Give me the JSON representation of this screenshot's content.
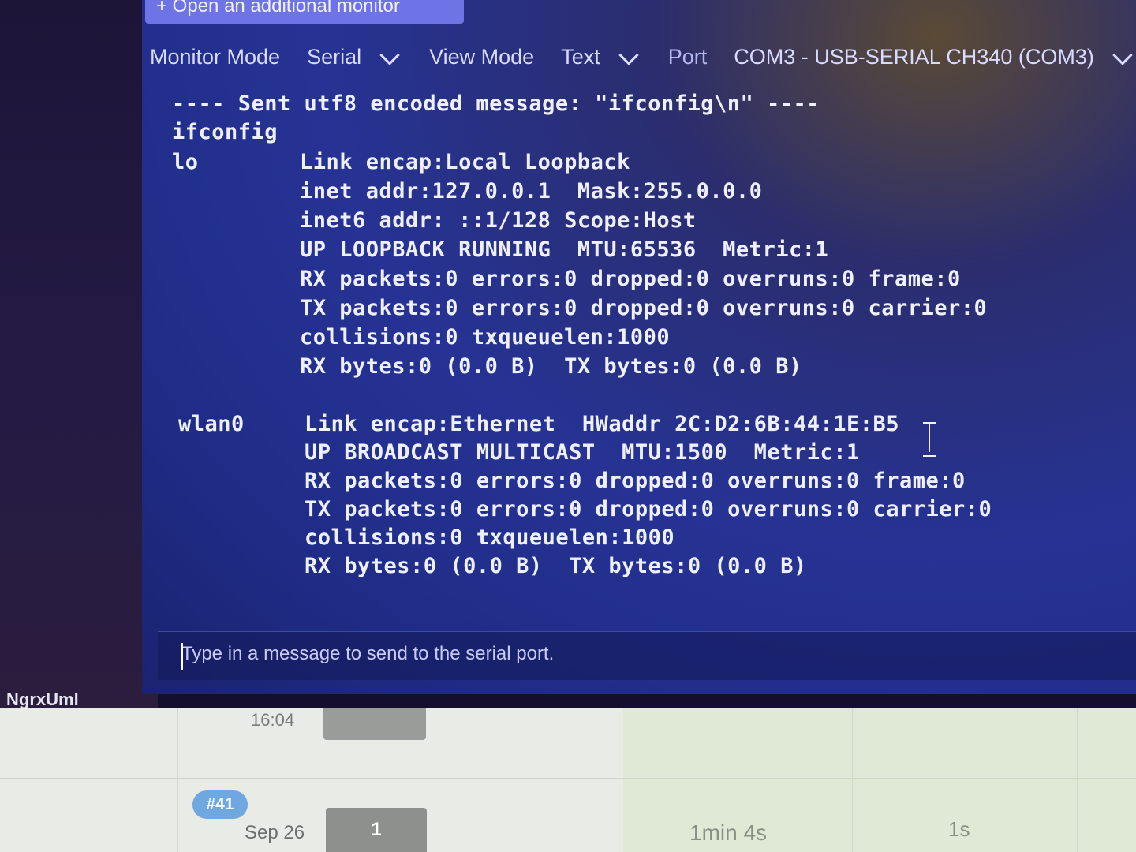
{
  "monitor": {
    "open_additional": "+ Open an additional monitor",
    "toolbar": {
      "monitor_mode_label": "Monitor Mode",
      "monitor_mode_value": "Serial",
      "view_mode_label": "View Mode",
      "view_mode_value": "Text",
      "port_label": "Port",
      "port_value": "COM3 - USB-SERIAL CH340 (COM3)"
    },
    "output": {
      "sent_line": "---- Sent utf8 encoded message: \"ifconfig\\n\" ----",
      "echo": "ifconfig",
      "interfaces": [
        {
          "name": "lo",
          "lines": [
            "Link encap:Local Loopback",
            "inet addr:127.0.0.1  Mask:255.0.0.0",
            "inet6 addr: ::1/128 Scope:Host",
            "UP LOOPBACK RUNNING  MTU:65536  Metric:1",
            "RX packets:0 errors:0 dropped:0 overruns:0 frame:0",
            "TX packets:0 errors:0 dropped:0 overruns:0 carrier:0",
            "collisions:0 txqueuelen:1000",
            "RX bytes:0 (0.0 B)  TX bytes:0 (0.0 B)"
          ]
        },
        {
          "name": "wlan0",
          "lines": [
            "Link encap:Ethernet  HWaddr 2C:D2:6B:44:1E:B5",
            "UP BROADCAST MULTICAST  MTU:1500  Metric:1",
            "RX packets:0 errors:0 dropped:0 overruns:0 frame:0",
            "TX packets:0 errors:0 dropped:0 overruns:0 carrier:0",
            "collisions:0 txqueuelen:1000",
            "RX bytes:0 (0.0 B)  TX bytes:0 (0.0 B)"
          ]
        }
      ]
    },
    "input_placeholder": "Type in a message to send to the serial port."
  },
  "sidebar_label": "NgrxUml",
  "runs": {
    "top_time": "16:04",
    "run_number": "#41",
    "date": "Sep 26",
    "count": "1",
    "duration": "1min 4s",
    "queue": "1s"
  },
  "colors": {
    "panel_blue": "#263394",
    "button_purple": "#6e74e6",
    "badge_blue": "#6fa7e0"
  }
}
